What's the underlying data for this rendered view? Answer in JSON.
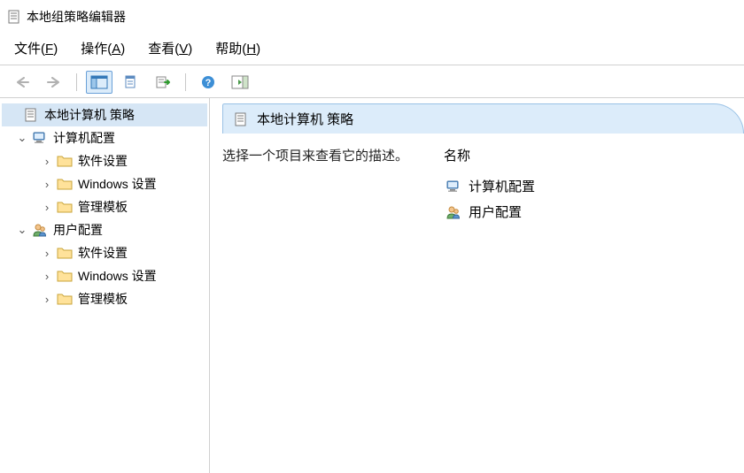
{
  "title": "本地组策略编辑器",
  "menu": {
    "file": {
      "label": "文件",
      "accel": "F"
    },
    "action": {
      "label": "操作",
      "accel": "A"
    },
    "view": {
      "label": "查看",
      "accel": "V"
    },
    "help": {
      "label": "帮助",
      "accel": "H"
    }
  },
  "toolbar_icons": {
    "back": "arrow-left-icon",
    "forward": "arrow-right-icon",
    "show_hide_tree": "tree-pane-icon",
    "properties": "properties-icon",
    "export_list": "export-icon",
    "help": "help-icon",
    "details": "details-pane-icon"
  },
  "tree": {
    "root": {
      "label": "本地计算机 策略"
    },
    "computer": {
      "label": "计算机配置"
    },
    "user": {
      "label": "用户配置"
    },
    "software": {
      "label": "软件设置"
    },
    "windows": {
      "label": "Windows 设置"
    },
    "admin": {
      "label": "管理模板"
    }
  },
  "content": {
    "header": "本地计算机 策略",
    "description": "选择一个项目来查看它的描述。",
    "column_name": "名称",
    "items": {
      "computer": "计算机配置",
      "user": "用户配置"
    }
  }
}
